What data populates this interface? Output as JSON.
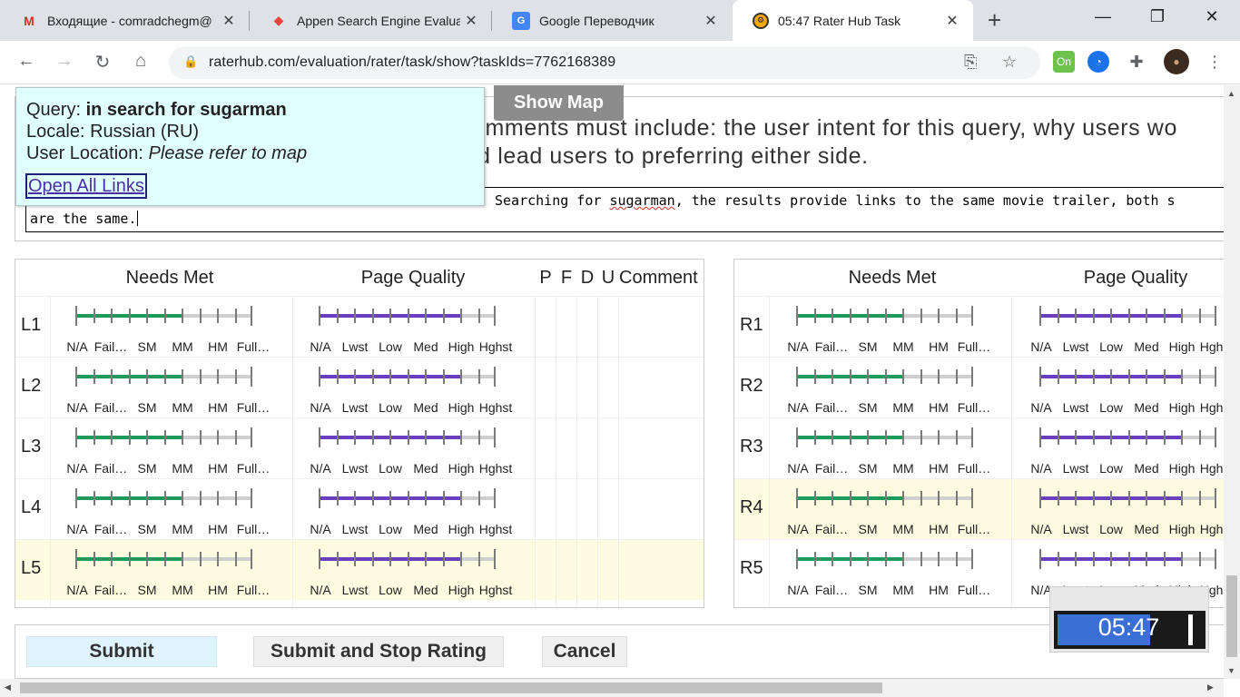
{
  "browser": {
    "tabs": [
      {
        "title": "Входящие - comradchegm@",
        "icon": "gmail-icon"
      },
      {
        "title": "Appen Search Engine Evalua",
        "icon": "appen-icon"
      },
      {
        "title": "Google Переводчик",
        "icon": "google-translate-icon"
      },
      {
        "title": "05:47 Rater Hub Task",
        "icon": "raterhub-icon",
        "active": true
      }
    ],
    "url": "raterhub.com/evaluation/rater/task/show?taskIds=7762168389"
  },
  "query_box": {
    "query_label": "Query:",
    "query_value": "in search for sugarman",
    "locale_label": "Locale:",
    "locale_value": "Russian (RU)",
    "location_label": "User Location:",
    "location_value": "Please refer to map",
    "open_all": "Open All Links"
  },
  "show_map": "Show Map",
  "instructions": {
    "line1": "omments must include: the user intent for this query, why users wo",
    "line2": "ld lead users to preferring either side."
  },
  "comment": {
    "line1_a": "Searching for ",
    "line1_word": "sugarman",
    "line1_b": ", the results provide links to the same movie trailer, both s",
    "line2": "are the same."
  },
  "left_panel": {
    "headers": {
      "needs_met": "Needs Met",
      "page_quality": "Page Quality",
      "p": "P",
      "f": "F",
      "d": "D",
      "u": "U",
      "comment": "Comment"
    },
    "rows": [
      {
        "label": "L1",
        "needs_met_level": 0.6,
        "page_quality_level": 0.8
      },
      {
        "label": "L2",
        "needs_met_level": 0.6,
        "page_quality_level": 0.8
      },
      {
        "label": "L3",
        "needs_met_level": 0.6,
        "page_quality_level": 0.8
      },
      {
        "label": "L4",
        "needs_met_level": 0.6,
        "page_quality_level": 0.8
      },
      {
        "label": "L5",
        "needs_met_level": 0.6,
        "page_quality_level": 0.8,
        "highlighted": true
      }
    ]
  },
  "right_panel": {
    "headers": {
      "needs_met": "Needs Met",
      "page_quality": "Page Quality"
    },
    "rows": [
      {
        "label": "R1",
        "needs_met_level": 0.6,
        "page_quality_level": 0.8
      },
      {
        "label": "R2",
        "needs_met_level": 0.6,
        "page_quality_level": 0.8
      },
      {
        "label": "R3",
        "needs_met_level": 0.6,
        "page_quality_level": 0.8
      },
      {
        "label": "R4",
        "needs_met_level": 0.6,
        "page_quality_level": 0.8,
        "highlighted": true
      },
      {
        "label": "R5",
        "needs_met_level": 0.6,
        "page_quality_level": 0.8
      }
    ]
  },
  "needs_met_labels": [
    "N/A",
    "Fail…",
    "SM",
    "MM",
    "HM",
    "Full…"
  ],
  "page_quality_labels": [
    "N/A",
    "Lwst",
    "Low",
    "Med",
    "High",
    "Hghst"
  ],
  "colors": {
    "needs_met": "#1e9a5a",
    "page_quality": "#6a3fbf",
    "highlight": "#fefce0"
  },
  "buttons": {
    "submit": "Submit",
    "submit_stop": "Submit and Stop Rating",
    "cancel": "Cancel"
  },
  "timer": {
    "text": "05:47",
    "progress": 0.62
  }
}
